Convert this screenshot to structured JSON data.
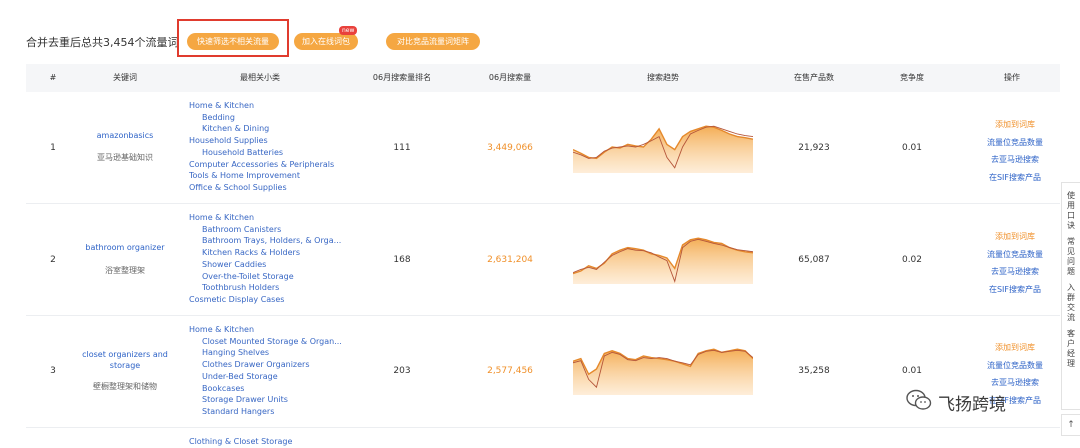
{
  "toolbar": {
    "summary": "合并去重后总共3,454个流量词",
    "filter_button": "快速筛选不相关流量",
    "add_button": "加入在线词包",
    "new_badge": "new",
    "compare_button": "对比竞品流量词矩阵"
  },
  "table": {
    "headers": [
      "#",
      "关键词",
      "最相关小类",
      "06月搜索量排名",
      "06月搜索量",
      "搜索趋势",
      "在售产品数",
      "竞争度",
      "操作"
    ],
    "rows": [
      {
        "index": "1",
        "keyword": "amazonbasics",
        "keyword_cn": "亚马逊基础知识",
        "categories": [
          {
            "text": "Home & Kitchen",
            "sub": false
          },
          {
            "text": "Bedding",
            "sub": true
          },
          {
            "text": "Kitchen & Dining",
            "sub": true
          },
          {
            "text": "Household Supplies",
            "sub": false
          },
          {
            "text": "Household Batteries",
            "sub": true
          },
          {
            "text": "Computer Accessories & Peripherals",
            "sub": false
          },
          {
            "text": "Tools & Home Improvement",
            "sub": false
          },
          {
            "text": "Office & School Supplies",
            "sub": false
          }
        ],
        "rank": "111",
        "volume": "3,449,066",
        "products": "21,923",
        "competition": "0.01",
        "trend": [
          0.55,
          0.62,
          0.7,
          0.72,
          0.6,
          0.5,
          0.52,
          0.45,
          0.48,
          0.5,
          0.35,
          0.15,
          0.45,
          0.55,
          0.3,
          0.2,
          0.15,
          0.1,
          0.12,
          0.18,
          0.25,
          0.3,
          0.32,
          0.35
        ],
        "trend2": [
          0.6,
          0.65,
          0.72,
          0.7,
          0.58,
          0.52,
          0.5,
          0.48,
          0.5,
          0.45,
          0.38,
          0.3,
          0.7,
          0.9,
          0.5,
          0.25,
          0.18,
          0.12,
          0.1,
          0.15,
          0.2,
          0.25,
          0.28,
          0.3
        ]
      },
      {
        "index": "2",
        "keyword": "bathroom organizer",
        "keyword_cn": "浴室整理架",
        "categories": [
          {
            "text": "Home & Kitchen",
            "sub": false
          },
          {
            "text": "Bathroom Canisters",
            "sub": true
          },
          {
            "text": "Bathroom Trays, Holders, & Orga...",
            "sub": true
          },
          {
            "text": "Kitchen Racks & Holders",
            "sub": true
          },
          {
            "text": "Shower Caddies",
            "sub": true
          },
          {
            "text": "Over-the-Toilet Storage",
            "sub": true
          },
          {
            "text": "Toothbrush Holders",
            "sub": true
          },
          {
            "text": "Cosmetic Display Cases",
            "sub": false
          }
        ],
        "rank": "168",
        "volume": "2,631,204",
        "products": "65,087",
        "competition": "0.02",
        "trend": [
          0.8,
          0.75,
          0.65,
          0.7,
          0.6,
          0.42,
          0.35,
          0.3,
          0.32,
          0.35,
          0.42,
          0.45,
          0.5,
          0.7,
          0.25,
          0.15,
          0.12,
          0.15,
          0.2,
          0.22,
          0.3,
          0.35,
          0.38,
          0.4
        ],
        "trend2": [
          0.78,
          0.72,
          0.68,
          0.72,
          0.58,
          0.45,
          0.38,
          0.32,
          0.35,
          0.36,
          0.4,
          0.48,
          0.55,
          0.95,
          0.3,
          0.18,
          0.14,
          0.18,
          0.22,
          0.25,
          0.3,
          0.34,
          0.36,
          0.38
        ]
      },
      {
        "index": "3",
        "keyword": "closet organizers and storage",
        "keyword_cn": "壁橱整理架和储物",
        "categories": [
          {
            "text": "Home & Kitchen",
            "sub": false
          },
          {
            "text": "Closet Mounted Storage & Organ...",
            "sub": true
          },
          {
            "text": "Hanging Shelves",
            "sub": true
          },
          {
            "text": "Clothes Drawer Organizers",
            "sub": true
          },
          {
            "text": "Under-Bed Storage",
            "sub": true
          },
          {
            "text": "Bookcases",
            "sub": true
          },
          {
            "text": "Storage Drawer Units",
            "sub": true
          },
          {
            "text": "Standard Hangers",
            "sub": true
          }
        ],
        "rank": "203",
        "volume": "2,577,456",
        "products": "35,258",
        "competition": "0.01",
        "trend": [
          0.35,
          0.3,
          0.6,
          0.5,
          0.2,
          0.15,
          0.2,
          0.3,
          0.32,
          0.25,
          0.28,
          0.3,
          0.32,
          0.35,
          0.4,
          0.45,
          0.2,
          0.15,
          0.12,
          0.18,
          0.15,
          0.12,
          0.15,
          0.3
        ],
        "trend2": [
          0.38,
          0.34,
          0.7,
          0.85,
          0.25,
          0.18,
          0.22,
          0.32,
          0.34,
          0.28,
          0.3,
          0.28,
          0.3,
          0.35,
          0.38,
          0.42,
          0.22,
          0.16,
          0.14,
          0.18,
          0.16,
          0.14,
          0.16,
          0.28
        ]
      }
    ],
    "partial_row_category": "Clothing & Closet Storage",
    "ops": [
      "添加到词库",
      "流量位竞品数量",
      "去亚马逊搜索",
      "在SIF搜索产品"
    ]
  },
  "side_panel": [
    "使",
    "用",
    "口",
    "诀",
    "",
    "常",
    "见",
    "问",
    "题",
    "",
    "入",
    "群",
    "交",
    "流",
    "",
    "客",
    "户",
    "经",
    "理"
  ],
  "watermark": "飞扬跨境",
  "colors": {
    "accent": "#f5a742",
    "link": "#2e63c7",
    "highlight": "#e03b2e"
  }
}
